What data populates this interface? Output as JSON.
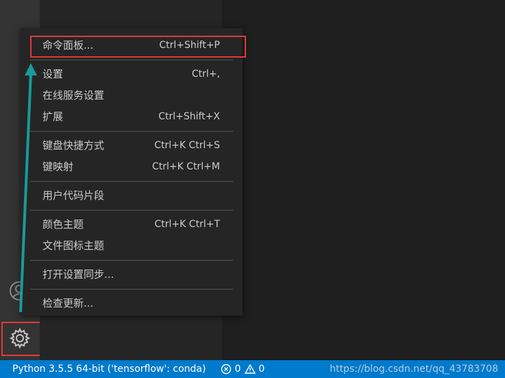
{
  "menu": {
    "items": [
      {
        "label": "命令面板...",
        "shortcut": "Ctrl+Shift+P"
      },
      {
        "label": "设置",
        "shortcut": "Ctrl+,"
      },
      {
        "label": "在线服务设置",
        "shortcut": ""
      },
      {
        "label": "扩展",
        "shortcut": "Ctrl+Shift+X"
      },
      {
        "label": "键盘快捷方式",
        "shortcut": "Ctrl+K Ctrl+S"
      },
      {
        "label": "键映射",
        "shortcut": "Ctrl+K Ctrl+M"
      },
      {
        "label": "用户代码片段",
        "shortcut": ""
      },
      {
        "label": "颜色主题",
        "shortcut": "Ctrl+K Ctrl+T"
      },
      {
        "label": "文件图标主题",
        "shortcut": ""
      },
      {
        "label": "打开设置同步...",
        "shortcut": ""
      },
      {
        "label": "检查更新...",
        "shortcut": ""
      }
    ]
  },
  "status_bar": {
    "python": "Python 3.5.5 64-bit ('tensorflow': conda)",
    "errors": "0",
    "warnings": "0",
    "watermark": "https://blog.csdn.net/qq_43783708"
  },
  "colors": {
    "highlight": "#e03a3a",
    "arrow": "#1a9a9a",
    "status_bar": "#007acc"
  }
}
